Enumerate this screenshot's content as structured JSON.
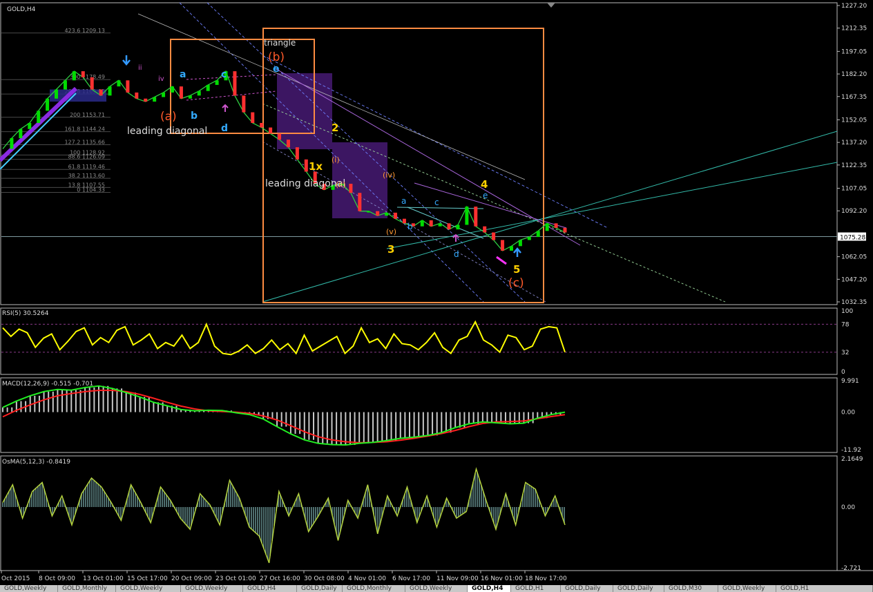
{
  "symbol_label": "GOLD,H4",
  "chart_data": [
    {
      "type": "line",
      "title": "GOLD,H4",
      "ylim": [
        1032.35,
        1227.2
      ],
      "y_ticks": [
        "1227.20",
        "1212.35",
        "1197.05",
        "1182.20",
        "1167.35",
        "1152.05",
        "1137.20",
        "1122.35",
        "1107.05",
        "1092.20",
        "1075.28",
        "1062.05",
        "1047.20",
        "1032.35"
      ],
      "current_price": "1075.28",
      "x_tick_labels": [
        "Oct 2015",
        "8 Oct 09:00",
        "13 Oct 01:00",
        "15 Oct 17:00",
        "20 Oct 09:00",
        "23 Oct 01:00",
        "27 Oct 16:00",
        "30 Oct 08:00",
        "4 Nov 01:00",
        "6 Nov 17:00",
        "11 Nov 09:00",
        "16 Nov 01:00",
        "18 Nov 17:00"
      ],
      "series": [
        {
          "values": [
            1133,
            1140,
            1146,
            1150,
            1158,
            1166,
            1172,
            1178,
            1184,
            1180,
            1172,
            1168,
            1174,
            1178,
            1170,
            1166,
            1164,
            1167,
            1170,
            1174,
            1166,
            1168,
            1171,
            1175,
            1178,
            1184,
            1168,
            1157,
            1150,
            1147,
            1143,
            1139,
            1134,
            1126,
            1118,
            1110,
            1106,
            1109,
            1110,
            1104,
            1092,
            1092,
            1089,
            1091,
            1087,
            1084,
            1082,
            1086,
            1082,
            1084,
            1080,
            1083,
            1095,
            1082,
            1078,
            1073,
            1066,
            1069,
            1073,
            1075,
            1079,
            1084,
            1081,
            1078
          ]
        }
      ],
      "fib_levels": [
        {
          "label": "423.6 1209.13",
          "price": 1209.13
        },
        {
          "label": "300 1178.49",
          "price": 1178.49
        },
        {
          "label": "261.8 1169.02",
          "price": 1169.02
        },
        {
          "label": "200 1153.71",
          "price": 1153.71
        },
        {
          "label": "161.8 1144.24",
          "price": 1144.24
        },
        {
          "label": "127.2 1135.66",
          "price": 1135.66
        },
        {
          "label": "100 1128.92",
          "price": 1128.92
        },
        {
          "label": "88.6 1126.09",
          "price": 1126.09
        },
        {
          "label": "61.8 1119.46",
          "price": 1119.46
        },
        {
          "label": "38.2 1113.60",
          "price": 1113.6
        },
        {
          "label": "13.8 1107.55",
          "price": 1107.55
        },
        {
          "label": "0 1104.33",
          "price": 1104.33
        }
      ],
      "annotations": [
        "triangle",
        "(b)",
        "e",
        "(a)",
        "a",
        "b",
        "c",
        "d",
        "leading diagonal",
        "2",
        "1x",
        "leading diagonal",
        "3",
        "4",
        "5",
        "(c)",
        "a",
        "b",
        "c",
        "d",
        "e",
        "ii",
        "iv",
        "(i)",
        "(ii)",
        "(iv)",
        "(v)"
      ]
    },
    {
      "type": "line",
      "title": "RSI(5) 30.5264",
      "ylim": [
        0,
        100
      ],
      "y_ticks": [
        "100",
        "78",
        "32",
        "0"
      ],
      "levels": [
        78,
        32
      ],
      "series": [
        {
          "name": "RSI(5)",
          "values": [
            72,
            58,
            70,
            64,
            40,
            55,
            62,
            36,
            50,
            66,
            72,
            44,
            56,
            48,
            68,
            74,
            44,
            52,
            62,
            38,
            48,
            42,
            60,
            38,
            48,
            78,
            42,
            30,
            28,
            34,
            44,
            30,
            38,
            52,
            36,
            46,
            30,
            60,
            34,
            42,
            50,
            58,
            30,
            42,
            72,
            48,
            54,
            38,
            62,
            46,
            44,
            36,
            48,
            64,
            40,
            30,
            52,
            58,
            82,
            52,
            44,
            32,
            60,
            56,
            36,
            42,
            70,
            74,
            72,
            32
          ]
        }
      ]
    },
    {
      "type": "bar",
      "title": "MACD(12,26,9) -0.515 -0.701",
      "ylim": [
        -11.92,
        9.991
      ],
      "y_ticks": [
        "9.991",
        "0.00",
        "-11.92"
      ],
      "series": [
        {
          "name": "MACD",
          "values": [
            1.5,
            3.5,
            5.2,
            6.5,
            7.2,
            7.0,
            7.8,
            8.3,
            7.5,
            6.2,
            4.8,
            3.1,
            2.0,
            0.8,
            0.4,
            0.6,
            0.5,
            -0.2,
            -0.8,
            -2.2,
            -4.6,
            -6.9,
            -8.8,
            -9.9,
            -10.3,
            -10.4,
            -9.9,
            -9.6,
            -9.0,
            -8.3,
            -7.9,
            -7.4,
            -6.5,
            -4.9,
            -3.7,
            -3.1,
            -3.4,
            -3.7,
            -3.5,
            -1.9,
            -0.8,
            0.0
          ]
        },
        {
          "name": "Signal",
          "values": [
            -1.5,
            0.6,
            2.3,
            3.9,
            5.2,
            5.9,
            6.5,
            6.9,
            6.9,
            6.5,
            5.6,
            4.4,
            3.1,
            1.9,
            1.0,
            0.4,
            0.2,
            0.0,
            -0.4,
            -1.2,
            -2.5,
            -4.3,
            -6.2,
            -7.8,
            -8.8,
            -9.4,
            -9.7,
            -9.6,
            -9.4,
            -8.9,
            -8.3,
            -7.6,
            -6.8,
            -5.8,
            -4.6,
            -3.6,
            -3.1,
            -3.0,
            -2.8,
            -2.1,
            -1.4,
            -0.8
          ]
        }
      ]
    },
    {
      "type": "bar",
      "title": "OsMA(5,12,3) -0.8419",
      "ylim": [
        -2.721,
        2.1649
      ],
      "y_ticks": [
        "2.1649",
        "0.00",
        "-2.721"
      ],
      "series": [
        {
          "name": "OsMA(5,12,3)",
          "values": [
            0.2,
            1.0,
            -0.5,
            0.7,
            1.1,
            -0.4,
            0.5,
            -0.8,
            0.6,
            1.3,
            0.9,
            0.2,
            -0.6,
            1.0,
            0.2,
            -0.7,
            0.9,
            0.3,
            -0.5,
            -1.0,
            0.6,
            0.1,
            -0.8,
            1.2,
            0.4,
            -0.9,
            -1.3,
            -2.5,
            0.7,
            -0.4,
            0.6,
            -1.1,
            -0.4,
            0.4,
            -1.5,
            0.3,
            -0.5,
            1.0,
            -1.2,
            0.5,
            -0.4,
            0.9,
            -0.7,
            0.5,
            -0.9,
            0.4,
            -0.5,
            -0.2,
            1.7,
            0.3,
            -1.0,
            0.6,
            -0.8,
            1.1,
            0.8,
            -0.4,
            0.5,
            -0.8
          ]
        }
      ]
    }
  ],
  "tabs": [
    "GOLD,Weekly",
    "GOLD,Monthly",
    "GOLD,Weekly",
    "GOLD,Weekly",
    "GOLD,H4",
    "GOLD,Daily",
    "GOLD,Monthly",
    "GOLD,Weekly",
    "GOLD,H4",
    "GOLD,H1",
    "GOLD,Daily",
    "GOLD,Daily",
    "GOLD,M30",
    "GOLD,Weekly",
    "GOLD,H1"
  ],
  "active_tab_index": 8
}
